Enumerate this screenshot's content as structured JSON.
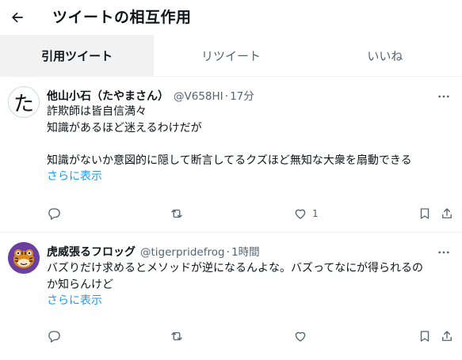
{
  "header": {
    "title": "ツイートの相互作用"
  },
  "tabs": [
    {
      "label": "引用ツイート"
    },
    {
      "label": "リツイート"
    },
    {
      "label": "いいね"
    }
  ],
  "tweets": [
    {
      "avatar_char": "た",
      "name": "他山小石（たやまさん）",
      "handle": "@V658HI",
      "dot": "·",
      "time": "17分",
      "lines": [
        "詐欺師は皆自信満々",
        "知識があるほど迷えるわけだが",
        "",
        "知識がないか意図的に隠して断言してるクズほど無知な大衆を扇動できる"
      ],
      "show_more": "さらに表示",
      "like_count": "1"
    },
    {
      "name": "虎威張るフロッグ",
      "handle": "@tigerpridefrog",
      "dot": "·",
      "time": "1時間",
      "lines": [
        "バズりだけ求めるとメソッドが逆になるんよな。バズってなにが得られるの",
        "か知らんけど"
      ],
      "show_more": "さらに表示",
      "like_count": ""
    }
  ],
  "colors": {
    "accent": "#1d9bf0",
    "muted": "#536471",
    "text": "#0f1419",
    "active_tab_bg": "#f2f2f2"
  }
}
